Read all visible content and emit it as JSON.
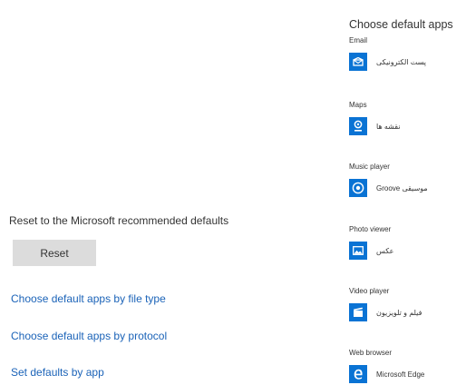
{
  "default_apps": {
    "title": "Choose default apps",
    "categories": [
      {
        "label": "Email",
        "app": "پست الکترونیکی",
        "icon": "mail-icon"
      },
      {
        "label": "Maps",
        "app": "نقشه ها",
        "icon": "maps-icon"
      },
      {
        "label": "Music player",
        "app": "Groove موسیقی",
        "icon": "groove-music-icon"
      },
      {
        "label": "Photo viewer",
        "app": "عکس",
        "icon": "photos-icon"
      },
      {
        "label": "Video player",
        "app": "فیلم و تلویزیون",
        "icon": "movies-tv-icon"
      },
      {
        "label": "Web browser",
        "app": "Microsoft Edge",
        "icon": "edge-icon"
      }
    ]
  },
  "reset": {
    "label": "Reset to the Microsoft recommended defaults",
    "button": "Reset"
  },
  "links": {
    "by_file_type": "Choose default apps by file type",
    "by_protocol": "Choose default apps by protocol",
    "set_by_app": "Set defaults by app"
  },
  "colors": {
    "accent": "#0a73d4",
    "link": "#1b63b8",
    "button_bg": "#dcdcdc"
  }
}
